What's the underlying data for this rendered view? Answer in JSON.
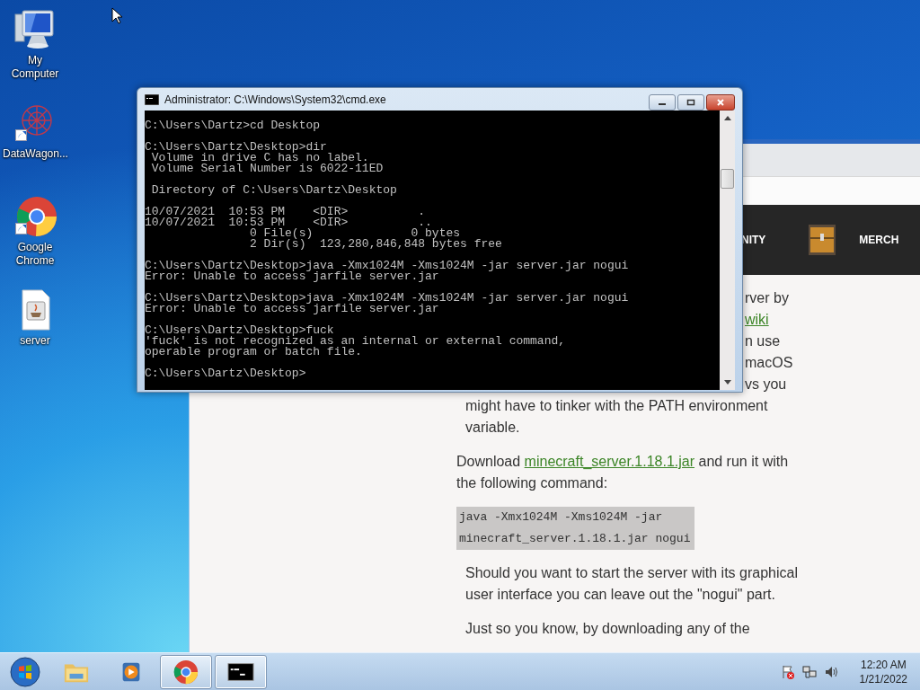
{
  "desktop_icons": [
    {
      "label": "My Computer",
      "kind": "computer",
      "shortcut": false
    },
    {
      "label": "DataWagon...",
      "kind": "network",
      "shortcut": true
    },
    {
      "label": "Google Chrome",
      "kind": "chrome",
      "shortcut": true
    },
    {
      "label": "server",
      "kind": "jar",
      "shortcut": false
    }
  ],
  "console_window": {
    "title": "Administrator: C:\\Windows\\System32\\cmd.exe",
    "blocks": [
      [
        "C:\\Users\\Dartz>cd Desktop"
      ],
      [
        "C:\\Users\\Dartz\\Desktop>dir",
        " Volume in drive C has no label.",
        " Volume Serial Number is 6022-11ED"
      ],
      [
        " Directory of C:\\Users\\Dartz\\Desktop"
      ],
      [
        "10/07/2021  10:53 PM    <DIR>          .",
        "10/07/2021  10:53 PM    <DIR>          ..",
        "               0 File(s)              0 bytes",
        "               2 Dir(s)  123,280,846,848 bytes free"
      ],
      [
        "C:\\Users\\Dartz\\Desktop>java -Xmx1024M -Xms1024M -jar server.jar nogui",
        "Error: Unable to access jarfile server.jar"
      ],
      [
        "C:\\Users\\Dartz\\Desktop>java -Xmx1024M -Xms1024M -jar server.jar nogui",
        "Error: Unable to access jarfile server.jar"
      ],
      [
        "C:\\Users\\Dartz\\Desktop>fuck",
        "'fuck' is not recognized as an internal or external command,",
        "operable program or batch file."
      ],
      [
        "C:\\Users\\Dartz\\Desktop>"
      ]
    ]
  },
  "browser": {
    "nav": [
      {
        "label": "NITY",
        "kind": "text"
      },
      {
        "label": "MERCH",
        "kind": "chest"
      }
    ],
    "partial_lines": [
      {
        "text": "rver by",
        "kind": "text"
      },
      {
        "text": "wiki",
        "kind": "link"
      },
      {
        "text": "n use",
        "kind": "text"
      },
      {
        "text": "macOS",
        "kind": "text"
      },
      {
        "text": "vs you",
        "kind": "text"
      }
    ],
    "paragraph_end": "might have to tinker with the PATH environment variable.",
    "download": {
      "before": "Download ",
      "link": "minecraft_server.1.18.1.jar",
      "after": " and run it with the following command:"
    },
    "code": "java -Xmx1024M -Xms1024M -jar minecraft_server.1.18.1.jar nogui",
    "paragraphs": [
      "Should you want to start the server with its graphical user interface you can leave out the \"nogui\" part.",
      "Just so you know, by downloading any of the"
    ]
  },
  "taskbar": {
    "items": [
      {
        "kind": "explorer",
        "running": false
      },
      {
        "kind": "media",
        "running": false
      },
      {
        "kind": "chrome",
        "running": true
      },
      {
        "kind": "console",
        "running": true
      }
    ],
    "clock": {
      "time": "12:20 AM",
      "date": "1/21/2022"
    }
  }
}
